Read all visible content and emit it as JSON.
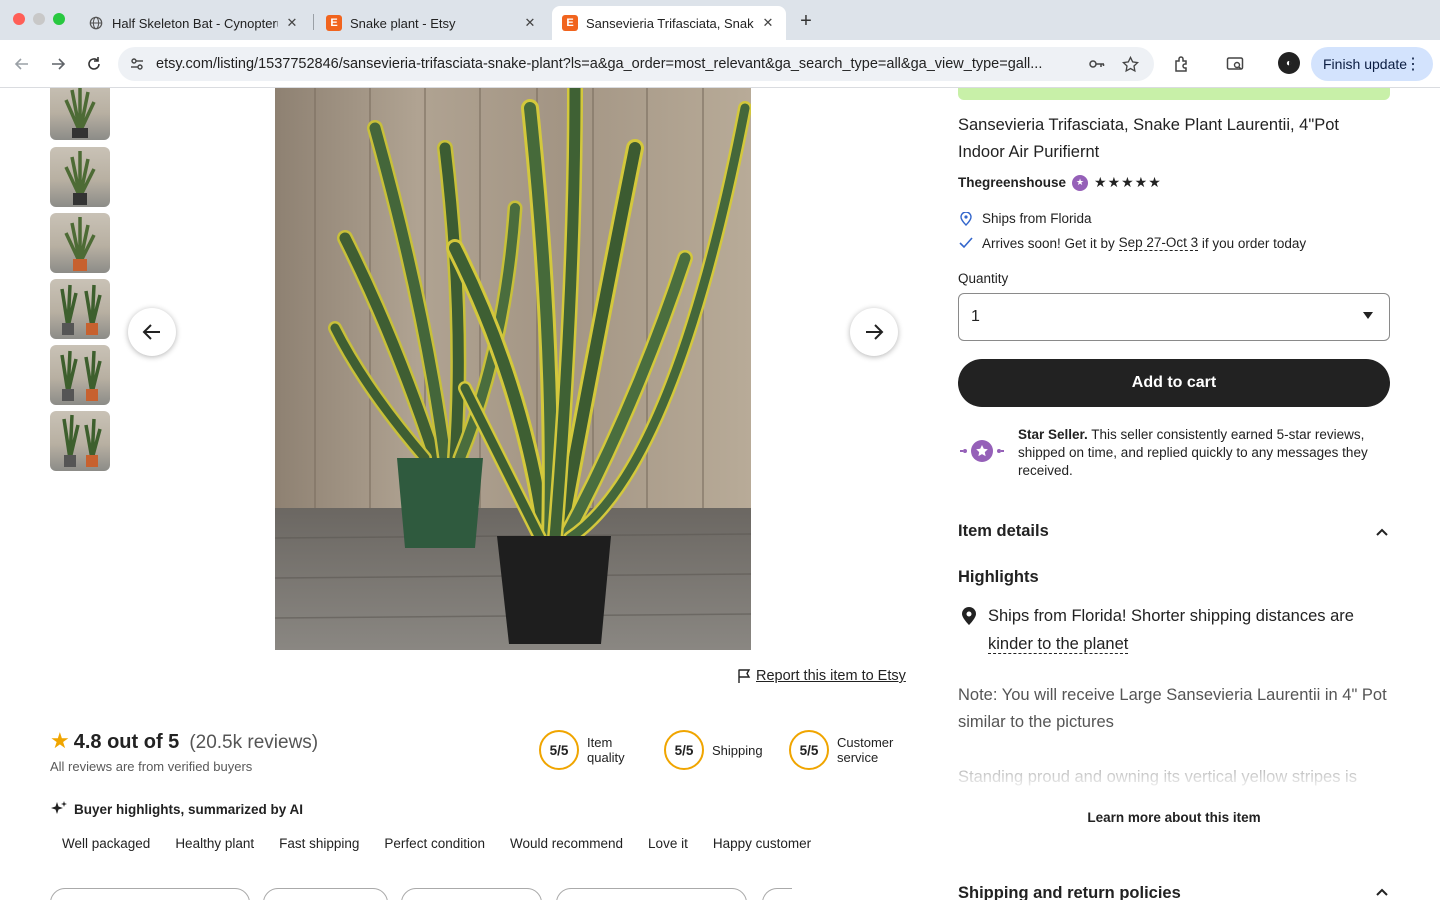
{
  "browser": {
    "tabs": [
      {
        "title": "Half Skeleton Bat - Cynopterus",
        "favicon": "globe-icon"
      },
      {
        "title": "Snake plant - Etsy",
        "favicon": "etsy-icon"
      },
      {
        "title": "Sansevieria Trifasciata, Snake",
        "favicon": "etsy-icon"
      }
    ],
    "etsy_favicon_letter": "E",
    "url": "etsy.com/listing/1537752846/sansevieria-trifasciata-snake-plant?ls=a&ga_order=most_relevant&ga_search_type=all&ga_view_type=gall...",
    "finish_update_label": "Finish update",
    "accent_color": "#d3e3fd"
  },
  "listing": {
    "title": "Sansevieria Trifasciata, Snake Plant Laurentii, 4\"Pot Indoor Air Purifiernt",
    "shop_name": "Thegreenshouse",
    "shop_stars": "★★★★★",
    "ships_from": "Ships from Florida",
    "arrives_prefix": "Arrives soon! Get it by ",
    "arrives_dates": "Sep 27-Oct 3",
    "arrives_suffix": " if you order today",
    "quantity_label": "Quantity",
    "quantity_value": "1",
    "add_to_cart_label": "Add to cart",
    "star_seller_title": "Star Seller.",
    "star_seller_text": " This seller consistently earned 5-star reviews, shipped on time, and replied quickly to any messages they received.",
    "item_details_label": "Item details",
    "highlights_label": "Highlights",
    "highlight_text_1": "Ships from Florida! Shorter shipping distances are ",
    "highlight_link": "kinder to the planet",
    "note_text": "Note: You will receive Large Sansevieria Laurentii in 4\" Pot similar to the pictures",
    "description_preview": "Standing proud and owning its vertical yellow stripes is",
    "learn_more_label": "Learn more about this item",
    "shipping_policies_label": "Shipping and return policies",
    "brand_color": "#f1641e",
    "star_seller_color": "#9560b8"
  },
  "gallery": {
    "report_label": "Report this item to Etsy",
    "thumbnail_count": 6
  },
  "reviews": {
    "rating_text": "4.8 out of 5",
    "review_count": "(20.5k reviews)",
    "verified_text": "All reviews are from verified buyers",
    "scores": [
      {
        "value": "5/5",
        "label_line1": "Item",
        "label_line2": "quality"
      },
      {
        "value": "5/5",
        "label_line1": "Shipping",
        "label_line2": ""
      },
      {
        "value": "5/5",
        "label_line1": "Customer",
        "label_line2": "service"
      }
    ],
    "ai_heading": "Buyer highlights, summarized by AI",
    "chips": [
      "Well packaged",
      "Healthy plant",
      "Fast shipping",
      "Perfect condition",
      "Would recommend",
      "Love it",
      "Happy customer"
    ],
    "star_color": "#f0a500"
  }
}
